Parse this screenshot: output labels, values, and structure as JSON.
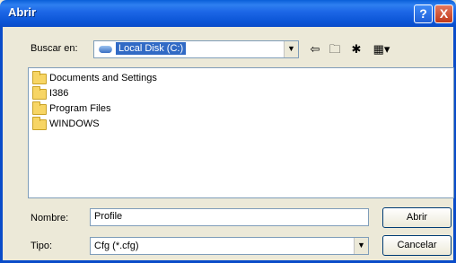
{
  "title": "Abrir",
  "titlebar": {
    "help_label": "?",
    "close_label": "X"
  },
  "lookin": {
    "label": "Buscar en:",
    "value": "Local Disk (C:)"
  },
  "toolbar": {
    "back_icon": "back-arrow-icon",
    "up_icon": "up-folder-icon",
    "new_folder_icon": "new-folder-icon",
    "views_icon": "views-menu-icon"
  },
  "files": [
    {
      "name": "Documents and Settings"
    },
    {
      "name": "I386"
    },
    {
      "name": "Program Files"
    },
    {
      "name": "WINDOWS"
    }
  ],
  "filename": {
    "label": "Nombre:",
    "value": "Profile"
  },
  "filetype": {
    "label": "Tipo:",
    "value": "Cfg (*.cfg)"
  },
  "buttons": {
    "open": "Abrir",
    "cancel": "Cancelar"
  },
  "colors": {
    "titlebar": "#0a55d6",
    "selection": "#316ac5",
    "dialog": "#ece9d8"
  }
}
